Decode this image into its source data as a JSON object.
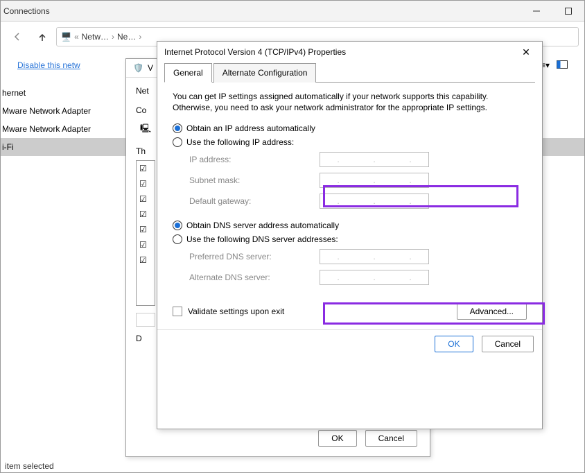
{
  "window": {
    "title": "Connections"
  },
  "breadcrumb": {
    "item1": "Netw…",
    "item2": "Ne…"
  },
  "toolbar": {
    "disable_label": "Disable this netw"
  },
  "list": {
    "items": [
      {
        "label": "hernet"
      },
      {
        "label": "Mware Network Adapter"
      },
      {
        "label": "Mware Network Adapter"
      },
      {
        "label": "i-Fi"
      }
    ]
  },
  "status": {
    "text": "item selected"
  },
  "subwindow": {
    "title_prefix": "V",
    "networking_label": "Net",
    "connect_label": "Co",
    "this_conn_label": "Th",
    "desc_label": "D",
    "ok": "OK",
    "cancel": "Cancel"
  },
  "dialog": {
    "title": "Internet Protocol Version 4 (TCP/IPv4) Properties",
    "tabs": {
      "general": "General",
      "alt": "Alternate Configuration"
    },
    "hint": "You can get IP settings assigned automatically if your network supports this capability. Otherwise, you need to ask your network administrator for the appropriate IP settings.",
    "radio_ip_auto": "Obtain an IP address automatically",
    "radio_ip_manual": "Use the following IP address:",
    "ip_address": "IP address:",
    "subnet": "Subnet mask:",
    "gateway": "Default gateway:",
    "radio_dns_auto": "Obtain DNS server address automatically",
    "radio_dns_manual": "Use the following DNS server addresses:",
    "dns_pref": "Preferred DNS server:",
    "dns_alt": "Alternate DNS server:",
    "validate": "Validate settings upon exit",
    "advanced": "Advanced...",
    "ok": "OK",
    "cancel": "Cancel"
  }
}
